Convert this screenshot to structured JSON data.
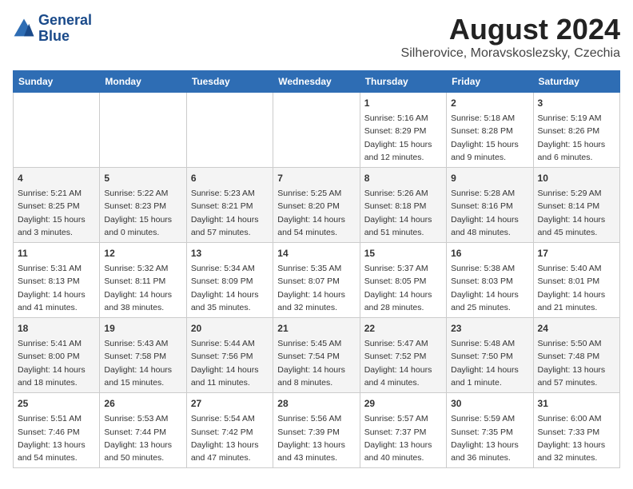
{
  "header": {
    "logo_line1": "General",
    "logo_line2": "Blue",
    "title": "August 2024",
    "subtitle": "Silherovice, Moravskoslezsky, Czechia"
  },
  "days_of_week": [
    "Sunday",
    "Monday",
    "Tuesday",
    "Wednesday",
    "Thursday",
    "Friday",
    "Saturday"
  ],
  "weeks": [
    [
      {
        "date": "",
        "info": ""
      },
      {
        "date": "",
        "info": ""
      },
      {
        "date": "",
        "info": ""
      },
      {
        "date": "",
        "info": ""
      },
      {
        "date": "1",
        "info": "Sunrise: 5:16 AM\nSunset: 8:29 PM\nDaylight: 15 hours\nand 12 minutes."
      },
      {
        "date": "2",
        "info": "Sunrise: 5:18 AM\nSunset: 8:28 PM\nDaylight: 15 hours\nand 9 minutes."
      },
      {
        "date": "3",
        "info": "Sunrise: 5:19 AM\nSunset: 8:26 PM\nDaylight: 15 hours\nand 6 minutes."
      }
    ],
    [
      {
        "date": "4",
        "info": "Sunrise: 5:21 AM\nSunset: 8:25 PM\nDaylight: 15 hours\nand 3 minutes."
      },
      {
        "date": "5",
        "info": "Sunrise: 5:22 AM\nSunset: 8:23 PM\nDaylight: 15 hours\nand 0 minutes."
      },
      {
        "date": "6",
        "info": "Sunrise: 5:23 AM\nSunset: 8:21 PM\nDaylight: 14 hours\nand 57 minutes."
      },
      {
        "date": "7",
        "info": "Sunrise: 5:25 AM\nSunset: 8:20 PM\nDaylight: 14 hours\nand 54 minutes."
      },
      {
        "date": "8",
        "info": "Sunrise: 5:26 AM\nSunset: 8:18 PM\nDaylight: 14 hours\nand 51 minutes."
      },
      {
        "date": "9",
        "info": "Sunrise: 5:28 AM\nSunset: 8:16 PM\nDaylight: 14 hours\nand 48 minutes."
      },
      {
        "date": "10",
        "info": "Sunrise: 5:29 AM\nSunset: 8:14 PM\nDaylight: 14 hours\nand 45 minutes."
      }
    ],
    [
      {
        "date": "11",
        "info": "Sunrise: 5:31 AM\nSunset: 8:13 PM\nDaylight: 14 hours\nand 41 minutes."
      },
      {
        "date": "12",
        "info": "Sunrise: 5:32 AM\nSunset: 8:11 PM\nDaylight: 14 hours\nand 38 minutes."
      },
      {
        "date": "13",
        "info": "Sunrise: 5:34 AM\nSunset: 8:09 PM\nDaylight: 14 hours\nand 35 minutes."
      },
      {
        "date": "14",
        "info": "Sunrise: 5:35 AM\nSunset: 8:07 PM\nDaylight: 14 hours\nand 32 minutes."
      },
      {
        "date": "15",
        "info": "Sunrise: 5:37 AM\nSunset: 8:05 PM\nDaylight: 14 hours\nand 28 minutes."
      },
      {
        "date": "16",
        "info": "Sunrise: 5:38 AM\nSunset: 8:03 PM\nDaylight: 14 hours\nand 25 minutes."
      },
      {
        "date": "17",
        "info": "Sunrise: 5:40 AM\nSunset: 8:01 PM\nDaylight: 14 hours\nand 21 minutes."
      }
    ],
    [
      {
        "date": "18",
        "info": "Sunrise: 5:41 AM\nSunset: 8:00 PM\nDaylight: 14 hours\nand 18 minutes."
      },
      {
        "date": "19",
        "info": "Sunrise: 5:43 AM\nSunset: 7:58 PM\nDaylight: 14 hours\nand 15 minutes."
      },
      {
        "date": "20",
        "info": "Sunrise: 5:44 AM\nSunset: 7:56 PM\nDaylight: 14 hours\nand 11 minutes."
      },
      {
        "date": "21",
        "info": "Sunrise: 5:45 AM\nSunset: 7:54 PM\nDaylight: 14 hours\nand 8 minutes."
      },
      {
        "date": "22",
        "info": "Sunrise: 5:47 AM\nSunset: 7:52 PM\nDaylight: 14 hours\nand 4 minutes."
      },
      {
        "date": "23",
        "info": "Sunrise: 5:48 AM\nSunset: 7:50 PM\nDaylight: 14 hours\nand 1 minute."
      },
      {
        "date": "24",
        "info": "Sunrise: 5:50 AM\nSunset: 7:48 PM\nDaylight: 13 hours\nand 57 minutes."
      }
    ],
    [
      {
        "date": "25",
        "info": "Sunrise: 5:51 AM\nSunset: 7:46 PM\nDaylight: 13 hours\nand 54 minutes."
      },
      {
        "date": "26",
        "info": "Sunrise: 5:53 AM\nSunset: 7:44 PM\nDaylight: 13 hours\nand 50 minutes."
      },
      {
        "date": "27",
        "info": "Sunrise: 5:54 AM\nSunset: 7:42 PM\nDaylight: 13 hours\nand 47 minutes."
      },
      {
        "date": "28",
        "info": "Sunrise: 5:56 AM\nSunset: 7:39 PM\nDaylight: 13 hours\nand 43 minutes."
      },
      {
        "date": "29",
        "info": "Sunrise: 5:57 AM\nSunset: 7:37 PM\nDaylight: 13 hours\nand 40 minutes."
      },
      {
        "date": "30",
        "info": "Sunrise: 5:59 AM\nSunset: 7:35 PM\nDaylight: 13 hours\nand 36 minutes."
      },
      {
        "date": "31",
        "info": "Sunrise: 6:00 AM\nSunset: 7:33 PM\nDaylight: 13 hours\nand 32 minutes."
      }
    ]
  ]
}
